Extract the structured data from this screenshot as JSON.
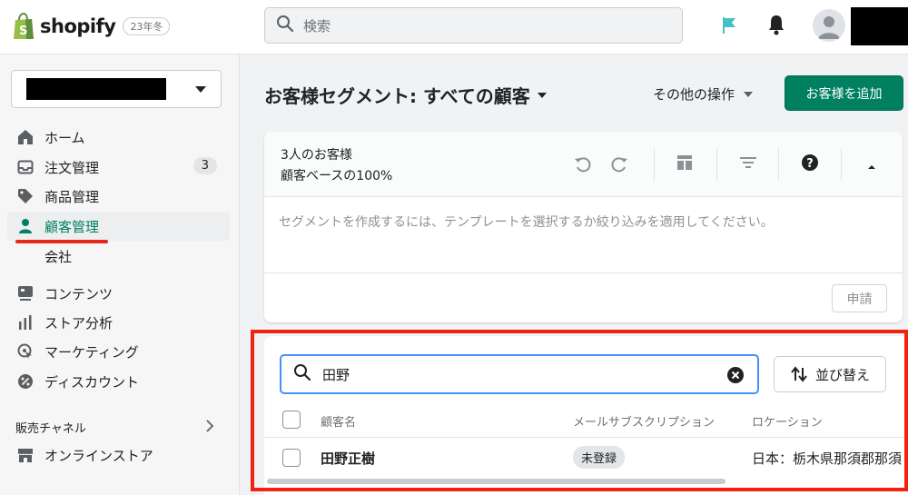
{
  "topbar": {
    "logo_text": "shopify",
    "logo_badge": "23年冬",
    "search_placeholder": "検索"
  },
  "sidebar": {
    "items": [
      {
        "label": "ホーム"
      },
      {
        "label": "注文管理",
        "badge": "3"
      },
      {
        "label": "商品管理"
      },
      {
        "label": "顧客管理"
      },
      {
        "label": "会社"
      },
      {
        "label": "コンテンツ"
      },
      {
        "label": "ストア分析"
      },
      {
        "label": "マーケティング"
      },
      {
        "label": "ディスカウント"
      }
    ],
    "section_label": "販売チャネル",
    "online_store_label": "オンラインストア"
  },
  "page": {
    "title": "お客様セグメント: すべての顧客",
    "more_actions_label": "その他の操作",
    "add_customer_label": "お客様を追加"
  },
  "segment": {
    "customer_count": "3人のお客様",
    "percent_of_base": "顧客ベースの100%",
    "hint": "セグメントを作成するには、テンプレートを選択するか絞り込みを適用してください。",
    "apply_label": "申請"
  },
  "customer_list": {
    "search_value": "田野",
    "sort_label": "並び替え",
    "columns": [
      "顧客名",
      "メールサブスクリプション",
      "ロケーション"
    ],
    "rows": [
      {
        "name": "田野正樹",
        "subscription": "未登録",
        "location": "日本：栃木県那須郡那須"
      }
    ]
  },
  "colors": {
    "accent_green": "#008060",
    "highlight_red": "#f3210f",
    "focus_blue": "#458fff"
  }
}
